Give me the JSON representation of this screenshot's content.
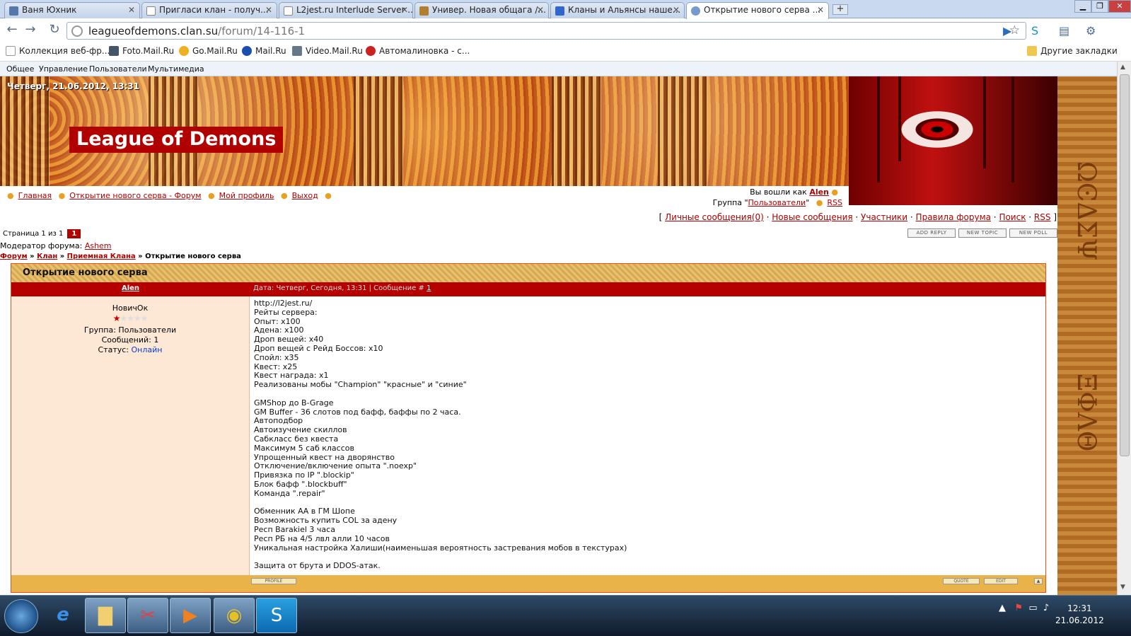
{
  "browser": {
    "tabs": [
      {
        "label": "Ваня Юхник",
        "color": "#5577aa"
      },
      {
        "label": "Пригласи клан - получ...",
        "color": "#ffffff"
      },
      {
        "label": "L2jest.ru Interlude Server ...",
        "color": "#ffffff"
      },
      {
        "label": "Универ. Новая общага /...",
        "color": "#b08030"
      },
      {
        "label": "Кланы и Альянсы наше...",
        "color": "#3366cc"
      },
      {
        "label": "Открытие нового серва ...",
        "color": "#7799cc"
      }
    ],
    "new_tab": "+",
    "url_host": "leagueofdemons.clan.su",
    "url_path": "/forum/14-116-1",
    "bookmarks": [
      {
        "label": "Коллекция веб-фр...",
        "color": "#dddddd"
      },
      {
        "label": "Foto.Mail.Ru",
        "color": "#445566"
      },
      {
        "label": "Go.Mail.Ru",
        "color": "#f0b020"
      },
      {
        "label": "Mail.Ru",
        "color": "#1a4fb0"
      },
      {
        "label": "Video.Mail.Ru",
        "color": "#667788"
      },
      {
        "label": "Автомалиновка - с...",
        "color": "#cc2222"
      }
    ],
    "other_bookmarks": "Другие закладки"
  },
  "adminbar": [
    "Общее",
    "Управление",
    "Пользователи",
    "Мультимедиа"
  ],
  "site": {
    "date": "Четверг, 21.06.2012, 13:31",
    "title": "League of Demons",
    "nav": [
      "Главная",
      "Открытие нового серва - Форум",
      "Мой профиль",
      "Выход"
    ],
    "login_prefix": "Вы вошли как",
    "login_user": "Alen",
    "group_prefix": "Группа \"",
    "group_name": "Пользователи",
    "group_suffix": "\"",
    "rss": "RSS",
    "userlinks": [
      "Личные сообщения(0)",
      "Новые сообщения",
      "Участники",
      "Правила форума",
      "Поиск",
      "RSS"
    ],
    "bracket_open": "[",
    "bracket_close": "]",
    "link_separator": " · "
  },
  "forum": {
    "pages_label": "Страница 1 из 1",
    "current_page": "1",
    "buttons": [
      "ADD REPLY",
      "NEW TOPIC",
      "NEW POLL"
    ],
    "moder_label": "Модератор форума:",
    "moder_name": "Ashem",
    "crumbs": [
      "Форум",
      "Клан",
      "Приемная Клана"
    ],
    "crumb_current": "Открытие нового серва",
    "crumb_separator": " » ",
    "topic_title": "Открытие нового серва",
    "post": {
      "author": "Alen",
      "meta_prefix": "Дата: Четверг, Сегодня, 13:31 | Сообщение #",
      "meta_num": "1",
      "rank": "НовичОк",
      "group": "Группа: Пользователи",
      "posts": "Сообщений: 1",
      "status_label": "Статус:",
      "status_value": "Онлайн",
      "rating_stars": "1 of 5",
      "body": "http://l2jest.ru/\nРейты сервера:\nОпыт: x100\nАдена: x100\nДроп вещей: x40\nДроп вещей с Рейд Боссов: x10\nСпойл: x35\nКвест: x25\nКвест награда: x1\nРеализованы мобы \"Champion\" \"красные\" и \"синие\"\n\nGMShop до B-Grage\nGM Buffer - 36 слотов под бафф, баффы по 2 часа.\nАвтоподбор\nАвтоизучение скиллов\nСабкласс без квеста\nМаксимум 5 саб классов\nУпрощенный квест на дворянство\nОтключение/включение опыта \".noexp\"\nПривязка по IP \".blockip\"\nБлок бафф \".blockbuff\"\nКоманда \".repair\"\n\nОбменник АА в ГМ Шопе\nВозможность купить COL за адену\nРесп Barakiel 3 часа\nРесп РБ на 4/5 лвл алли 10 часов\nУникальная настройка Халиши(наименьшая вероятность застревания мобов в текстурах)\n\nЗащита от брута и DDOS-атак.",
      "foot_buttons": [
        "PROFILE",
        "QUOTE",
        "EDIT"
      ]
    }
  },
  "taskbar": {
    "clock_time": "12:31",
    "clock_date": "21.06.2012"
  }
}
